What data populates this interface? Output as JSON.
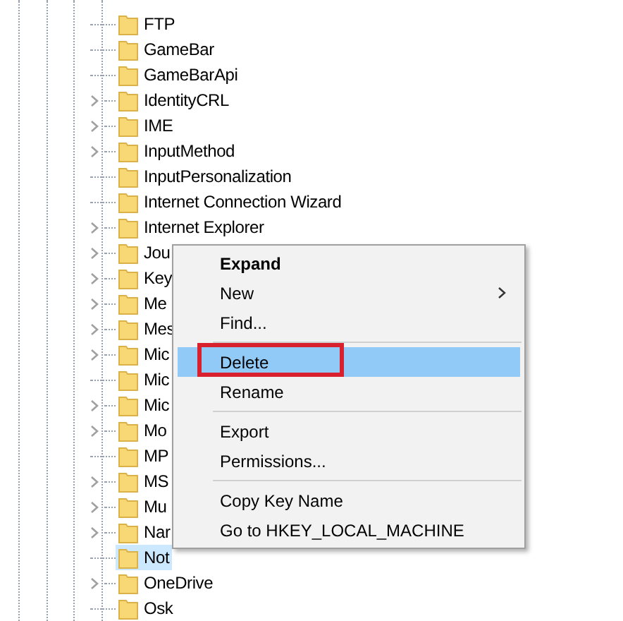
{
  "tree": {
    "items": [
      {
        "label": "FTP",
        "expandable": false,
        "selected": false
      },
      {
        "label": "GameBar",
        "expandable": false,
        "selected": false
      },
      {
        "label": "GameBarApi",
        "expandable": false,
        "selected": false
      },
      {
        "label": "IdentityCRL",
        "expandable": true,
        "selected": false
      },
      {
        "label": "IME",
        "expandable": true,
        "selected": false
      },
      {
        "label": "InputMethod",
        "expandable": true,
        "selected": false
      },
      {
        "label": "InputPersonalization",
        "expandable": false,
        "selected": false
      },
      {
        "label": "Internet Connection Wizard",
        "expandable": false,
        "selected": false
      },
      {
        "label": "Internet Explorer",
        "expandable": true,
        "selected": false
      },
      {
        "label": "Jou",
        "expandable": true,
        "selected": false
      },
      {
        "label": "Key",
        "expandable": true,
        "selected": false
      },
      {
        "label": "Me",
        "expandable": true,
        "selected": false
      },
      {
        "label": "Mes",
        "expandable": true,
        "selected": false
      },
      {
        "label": "Mic",
        "expandable": true,
        "selected": false
      },
      {
        "label": "Mic",
        "expandable": false,
        "selected": false
      },
      {
        "label": "Mic",
        "expandable": true,
        "selected": false
      },
      {
        "label": "Mo",
        "expandable": true,
        "selected": false
      },
      {
        "label": "MP",
        "expandable": false,
        "selected": false
      },
      {
        "label": "MS",
        "expandable": true,
        "selected": false
      },
      {
        "label": "Mu",
        "expandable": true,
        "selected": false
      },
      {
        "label": "Nar",
        "expandable": true,
        "selected": false
      },
      {
        "label": "Not",
        "expandable": false,
        "selected": true
      },
      {
        "label": "OneDrive",
        "expandable": true,
        "selected": false
      },
      {
        "label": "Osk",
        "expandable": false,
        "selected": false
      }
    ]
  },
  "context_menu": {
    "items": [
      {
        "kind": "item",
        "label": "Expand",
        "bold": true,
        "selected": false,
        "submenu": false,
        "annotated": false
      },
      {
        "kind": "item",
        "label": "New",
        "bold": false,
        "selected": false,
        "submenu": true,
        "annotated": false
      },
      {
        "kind": "item",
        "label": "Find...",
        "bold": false,
        "selected": false,
        "submenu": false,
        "annotated": false
      },
      {
        "kind": "separator"
      },
      {
        "kind": "item",
        "label": "Delete",
        "bold": false,
        "selected": true,
        "submenu": false,
        "annotated": true
      },
      {
        "kind": "item",
        "label": "Rename",
        "bold": false,
        "selected": false,
        "submenu": false,
        "annotated": false
      },
      {
        "kind": "separator"
      },
      {
        "kind": "item",
        "label": "Export",
        "bold": false,
        "selected": false,
        "submenu": false,
        "annotated": false
      },
      {
        "kind": "item",
        "label": "Permissions...",
        "bold": false,
        "selected": false,
        "submenu": false,
        "annotated": false
      },
      {
        "kind": "separator"
      },
      {
        "kind": "item",
        "label": "Copy Key Name",
        "bold": false,
        "selected": false,
        "submenu": false,
        "annotated": false
      },
      {
        "kind": "item",
        "label": "Go to HKEY_LOCAL_MACHINE",
        "bold": false,
        "selected": false,
        "submenu": false,
        "annotated": false
      }
    ]
  }
}
